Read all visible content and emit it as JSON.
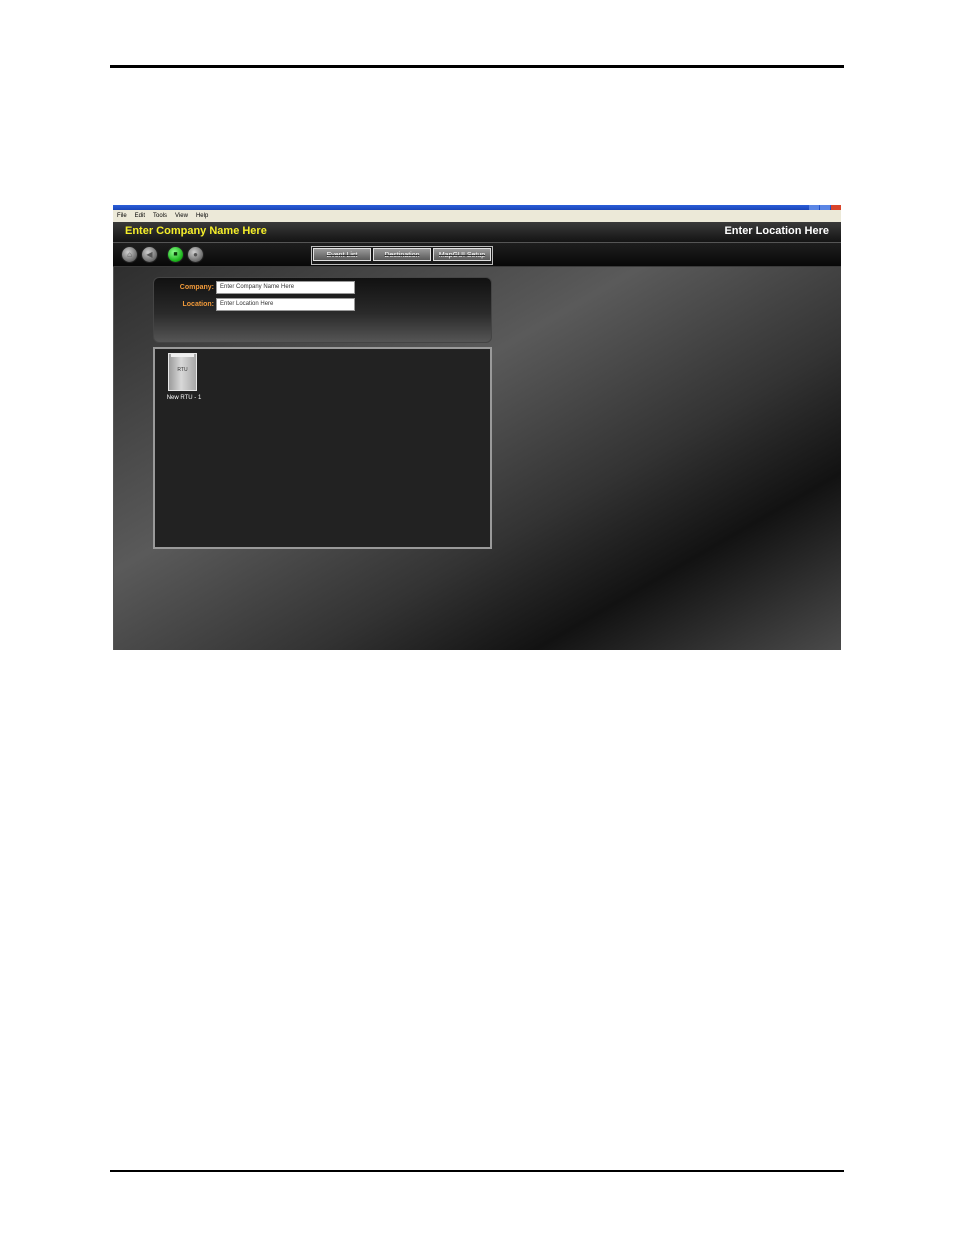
{
  "menubar": {
    "items": [
      "File",
      "Edit",
      "Tools",
      "View",
      "Help"
    ]
  },
  "header": {
    "company_title": "Enter Company Name Here",
    "location_title": "Enter Location Here"
  },
  "toolbar": {
    "round_buttons": [
      "home-icon",
      "back-icon",
      "stop-icon",
      "record-icon"
    ],
    "tabs": [
      "Event List",
      "Destination",
      "MapGUI Setup"
    ]
  },
  "info_panel": {
    "company_label": "Company:",
    "company_value": "Enter Company Name Here",
    "location_label": "Location:",
    "location_value": "Enter Location Here"
  },
  "device_panel": {
    "devices": [
      {
        "icon_label": "RTU",
        "name": "New RTU - 1"
      }
    ]
  },
  "colors": {
    "company_title": "#f5ee2a",
    "field_label": "#f19a3a",
    "active_button": "#1db51d"
  }
}
